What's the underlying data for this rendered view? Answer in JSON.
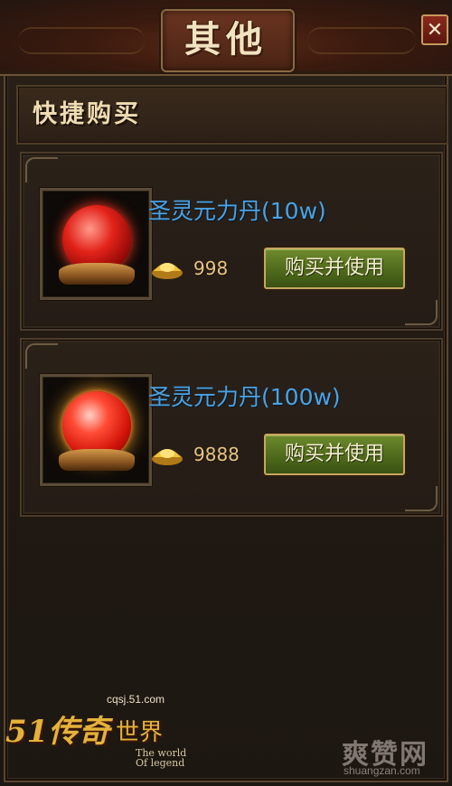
{
  "window": {
    "title": "其他",
    "close_label": "✕"
  },
  "section": {
    "title": "快捷购买"
  },
  "items": [
    {
      "name": "圣灵元力丹(10w)",
      "price": "998",
      "button_label": "购买并使用"
    },
    {
      "name": "圣灵元力丹(100w)",
      "price": "9888",
      "button_label": "购买并使用"
    }
  ],
  "watermarks": {
    "game_url": "cqsj.51.com",
    "game_logo": "51传奇",
    "game_logo_suffix": "世界",
    "game_sub": "The world Of legend",
    "site_logo": "爽赞网",
    "site_url": "shuangzan.com"
  },
  "colors": {
    "item_name": "#4aa2e4",
    "price": "#e6c584",
    "buy_button": "#4f6a1c",
    "title_text": "#f1e3c0"
  }
}
